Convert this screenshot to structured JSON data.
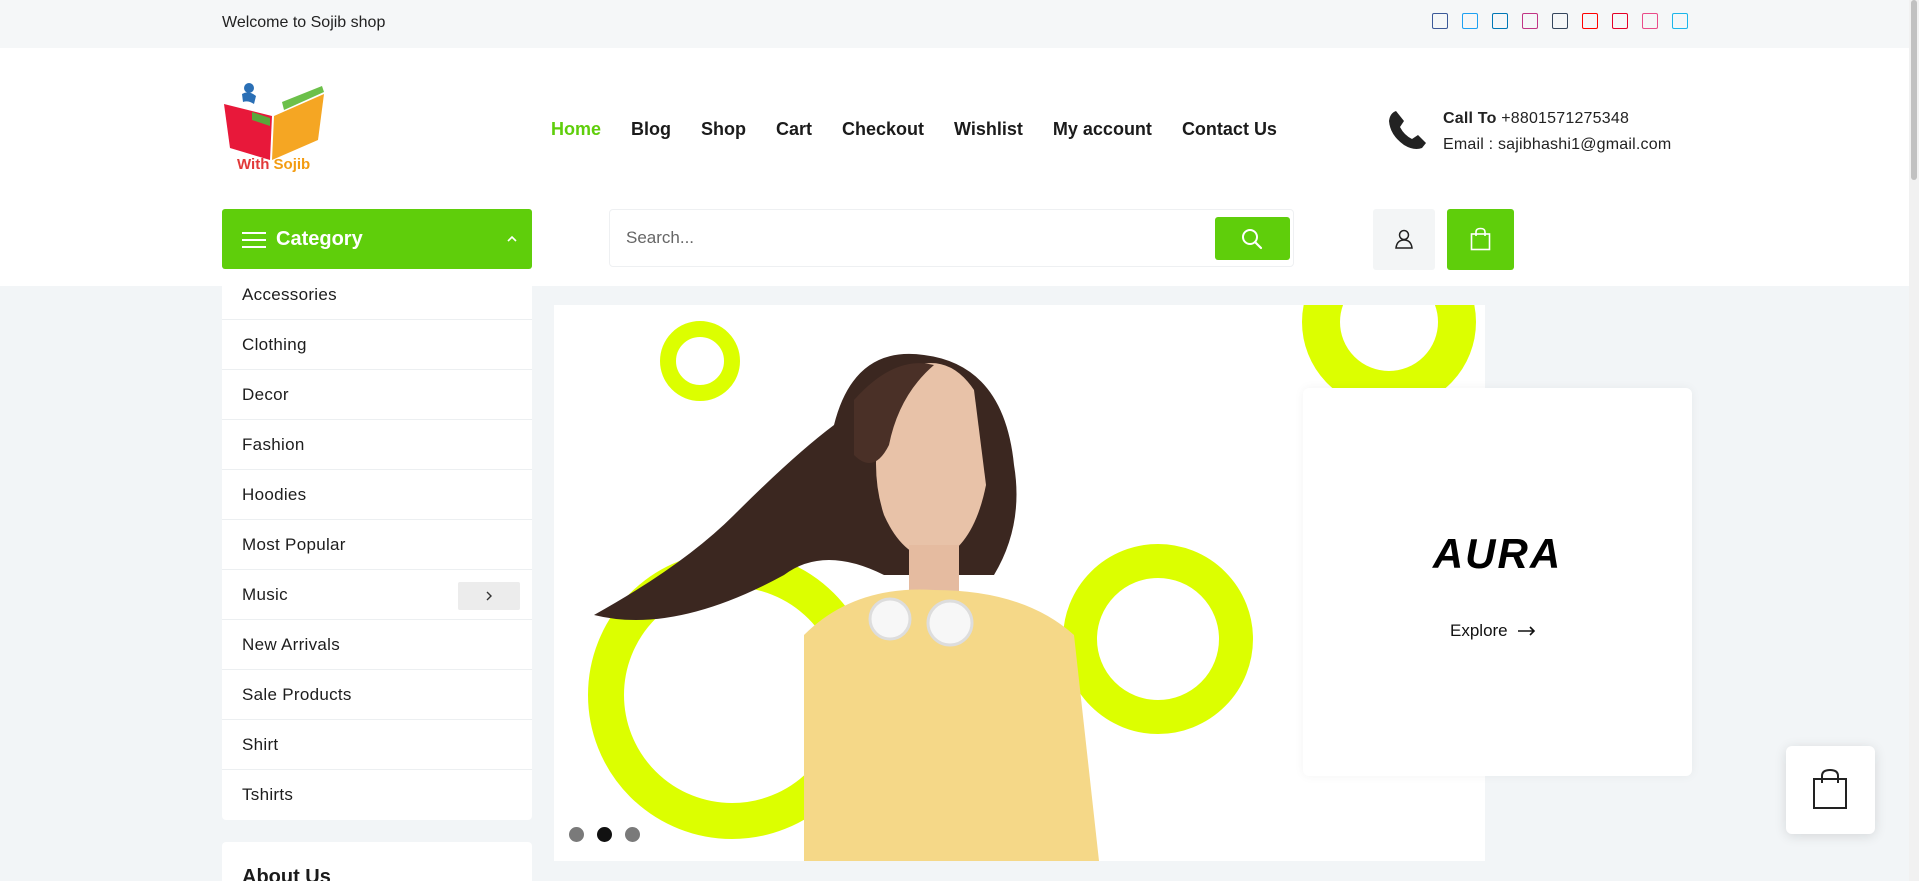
{
  "topbar": {
    "welcome": "Welcome to Sojib shop",
    "social_icons": [
      {
        "name": "facebook-icon",
        "color": "#3b5998"
      },
      {
        "name": "twitter-icon",
        "color": "#1da1f2"
      },
      {
        "name": "linkedin-icon",
        "color": "#0077b5"
      },
      {
        "name": "instagram-icon",
        "color": "#c13584"
      },
      {
        "name": "tumblr-icon",
        "color": "#35465c"
      },
      {
        "name": "youtube-icon",
        "color": "#ff0000"
      },
      {
        "name": "pinterest-icon",
        "color": "#e60023"
      },
      {
        "name": "dribbble-icon",
        "color": "#ea4c89"
      },
      {
        "name": "vimeo-icon",
        "color": "#1ab7ea"
      }
    ]
  },
  "logo": {
    "text_part1": "With ",
    "text_part2": "Sojib"
  },
  "nav": {
    "items": [
      "Home",
      "Blog",
      "Shop",
      "Cart",
      "Checkout",
      "Wishlist",
      "My account",
      "Contact Us"
    ],
    "active": "Home"
  },
  "contact": {
    "call_label": "Call To",
    "phone": "+8801571275348",
    "email_line": "Email : sajibhashi1@gmail.com"
  },
  "category": {
    "title": "Category",
    "items": [
      "Accessories",
      "Clothing",
      "Decor",
      "Fashion",
      "Hoodies",
      "Most Popular",
      "Music",
      "New Arrivals",
      "Sale Products",
      "Shirt",
      "Tshirts"
    ],
    "has_submenu": "Music"
  },
  "about": {
    "title": "About Us"
  },
  "search": {
    "placeholder": "Search..."
  },
  "hero": {
    "brand": "AURA",
    "cta": "Explore",
    "slides": 3,
    "active_slide": 2,
    "accent_color": "#dcff00"
  },
  "colors": {
    "primary": "#5fce0b",
    "accent": "#dcff00"
  }
}
